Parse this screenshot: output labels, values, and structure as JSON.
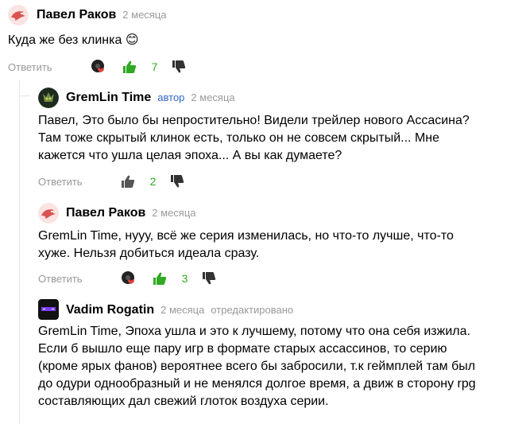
{
  "comments": [
    {
      "author": "Павел Раков",
      "time": "2 месяца",
      "text": "Куда же без клинка 😊",
      "reply_label": "Ответить",
      "likes": "7"
    },
    {
      "author": "GremLin Time",
      "badge": "автор",
      "time": "2 месяца",
      "lines": [
        "Павел, Это было бы непростительно! Видели трейлер нового Ассасина?",
        "Там тоже скрытый клинок есть, только он не совсем скрытый... Мне",
        "кажется что ушла целая эпоха... А вы как думаете?"
      ],
      "reply_label": "Ответить",
      "likes": "2"
    },
    {
      "author": "Павел Раков",
      "time": "2 месяца",
      "lines": [
        "GremLin Time, нууу, всё же серия изменилась, но что-то лучше, что-то",
        "хуже. Нельзя добиться идеала сразу."
      ],
      "reply_label": "Ответить",
      "likes": "3"
    },
    {
      "author": "Vadim Rogatin",
      "time": "2 месяца",
      "edited": "отредактировано",
      "lines": [
        "GremLin Time, Эпоха ушла и это к лучшему, потому что она себя изжила.",
        "Если б вышло еще пару игр в формате старых ассассинов, то серию",
        "(кроме ярых фанов) вероятнее всего бы забросили, т.к геймплей там был",
        "до одури однообразный и не менялся долгое время, а движ в сторону rpg",
        "составляющих дал свежий глоток воздуха серии."
      ]
    }
  ],
  "icons": {
    "like": "thumb-up-icon",
    "dislike": "thumb-down-icon",
    "reaction": "reaction-heart-icon"
  },
  "colors": {
    "like_active": "#2faa22",
    "muted": "#999999",
    "author_badge": "#3366cc",
    "avatar_red": "#d9534f"
  }
}
